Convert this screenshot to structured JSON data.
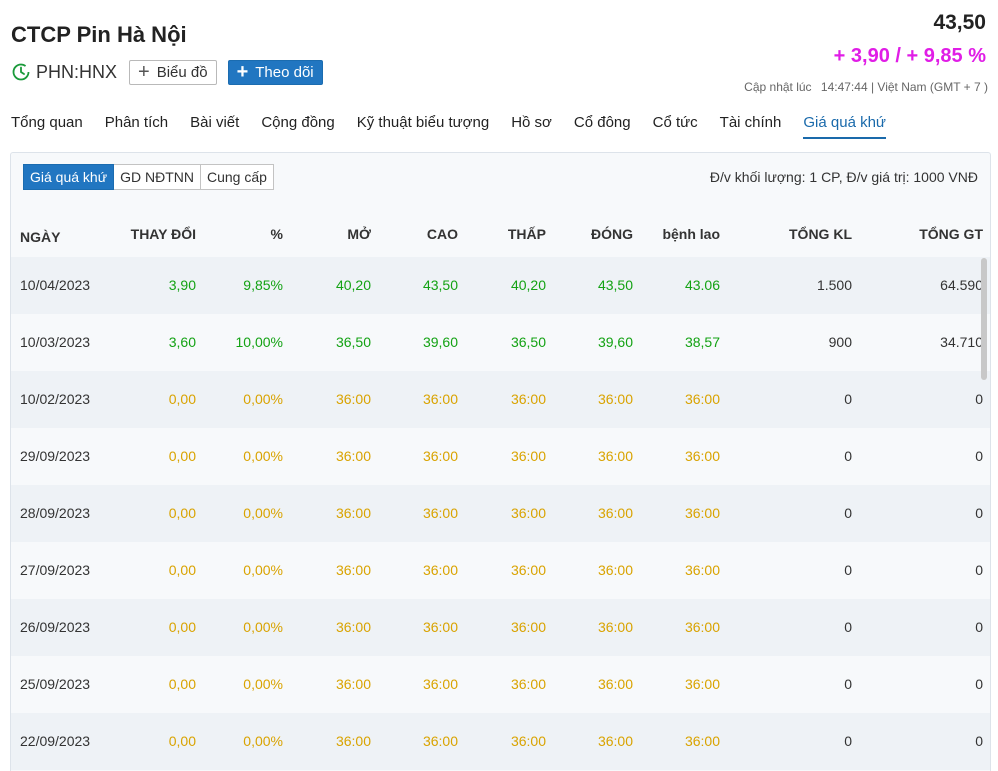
{
  "header": {
    "company": "CTCP Pin Hà Nội",
    "ticker": "PHN:HNX",
    "chart_button": "Biểu đồ",
    "follow_button": "Theo dõi",
    "price": "43,50",
    "change": "+ 3,90 / + 9,85 %",
    "updated_label": "Cập nhật lúc",
    "updated_time": "14:47:44 | Việt Nam (GMT + 7 )"
  },
  "tabs": [
    {
      "label": "Tổng quan"
    },
    {
      "label": "Phân tích"
    },
    {
      "label": "Bài viết"
    },
    {
      "label": "Cộng đồng"
    },
    {
      "label": "Kỹ thuật biểu tượng"
    },
    {
      "label": "Hồ sơ"
    },
    {
      "label": "Cổ đông"
    },
    {
      "label": "Cổ tức"
    },
    {
      "label": "Tài chính"
    },
    {
      "label": "Giá quá khứ",
      "active": true
    }
  ],
  "panel": {
    "segments": [
      "Giá quá khứ",
      "GD NĐTNN",
      "Cung cấp"
    ],
    "unit_note": "Đ/v khối lượng: 1 CP, Đ/v giá trị: 1000 VNĐ"
  },
  "table": {
    "columns": [
      "NGÀY",
      "THAY ĐỔI",
      "%",
      "MỞ",
      "CAO",
      "THẤP",
      "ĐÓNG",
      "bệnh lao",
      "TỔNG KL",
      "TỔNG GT"
    ],
    "rows": [
      {
        "tone": "g",
        "cells": [
          "10/04/2023",
          "3,90",
          "9,85%",
          "40,20",
          "43,50",
          "40,20",
          "43,50",
          "43.06",
          "1.500",
          "64.590"
        ]
      },
      {
        "tone": "g",
        "cells": [
          "10/03/2023",
          "3,60",
          "10,00%",
          "36,50",
          "39,60",
          "36,50",
          "39,60",
          "38,57",
          "900",
          "34.710"
        ]
      },
      {
        "tone": "y",
        "cells": [
          "10/02/2023",
          "0,00",
          "0,00%",
          "36:00",
          "36:00",
          "36:00",
          "36:00",
          "36:00",
          "0",
          "0"
        ]
      },
      {
        "tone": "y",
        "cells": [
          "29/09/2023",
          "0,00",
          "0,00%",
          "36:00",
          "36:00",
          "36:00",
          "36:00",
          "36:00",
          "0",
          "0"
        ]
      },
      {
        "tone": "y",
        "cells": [
          "28/09/2023",
          "0,00",
          "0,00%",
          "36:00",
          "36:00",
          "36:00",
          "36:00",
          "36:00",
          "0",
          "0"
        ]
      },
      {
        "tone": "y",
        "cells": [
          "27/09/2023",
          "0,00",
          "0,00%",
          "36:00",
          "36:00",
          "36:00",
          "36:00",
          "36:00",
          "0",
          "0"
        ]
      },
      {
        "tone": "y",
        "cells": [
          "26/09/2023",
          "0,00",
          "0,00%",
          "36:00",
          "36:00",
          "36:00",
          "36:00",
          "36:00",
          "0",
          "0"
        ]
      },
      {
        "tone": "y",
        "cells": [
          "25/09/2023",
          "0,00",
          "0,00%",
          "36:00",
          "36:00",
          "36:00",
          "36:00",
          "36:00",
          "0",
          "0"
        ]
      },
      {
        "tone": "y",
        "cells": [
          "22/09/2023",
          "0,00",
          "0,00%",
          "36:00",
          "36:00",
          "36:00",
          "36:00",
          "36:00",
          "0",
          "0"
        ]
      }
    ]
  },
  "colors": {
    "up": "#13a213",
    "flat": "#d9a300",
    "accent": "#2176c1",
    "change": "#e01de6"
  },
  "icons": {
    "clock": "clock-refresh-icon",
    "plus": "plus-icon"
  }
}
